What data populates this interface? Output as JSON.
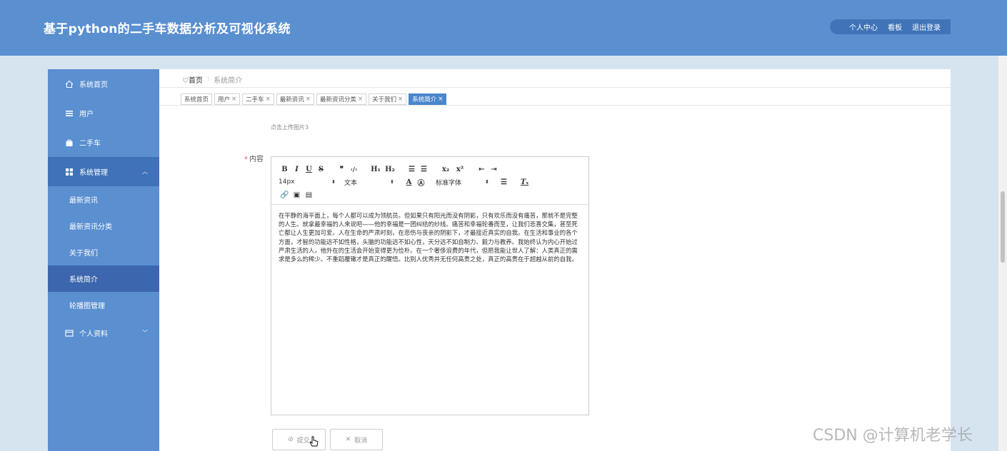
{
  "app": {
    "title": "基于python的二手车数据分析及可视化系统"
  },
  "top_actions": [
    "个人中心",
    "看板",
    "退出登录"
  ],
  "sidebar": {
    "items": [
      {
        "label": "系统首页",
        "icon": "home-icon"
      },
      {
        "label": "用户",
        "icon": "list-icon"
      },
      {
        "label": "二手车",
        "icon": "bag-icon"
      },
      {
        "label": "系统管理",
        "icon": "grid-icon",
        "expanded": true,
        "children": [
          "最新资讯",
          "最新资讯分类",
          "关于我们",
          "系统简介",
          "轮播图管理"
        ],
        "active_child": "系统简介"
      },
      {
        "label": "个人资料",
        "icon": "card-icon",
        "expanded": false
      }
    ]
  },
  "breadcrumb": {
    "home": "首页",
    "current": "系统简介"
  },
  "tabs": [
    {
      "label": "系统首页",
      "closable": false
    },
    {
      "label": "用户",
      "closable": true
    },
    {
      "label": "二手车",
      "closable": true
    },
    {
      "label": "最新资讯",
      "closable": true
    },
    {
      "label": "最新资讯分类",
      "closable": true
    },
    {
      "label": "关于我们",
      "closable": true
    },
    {
      "label": "系统简介",
      "closable": true,
      "active": true
    }
  ],
  "form": {
    "upload_hint": "点击上传图片3",
    "content_label": "内容",
    "editor": {
      "font_size": "14px",
      "header_select": "文本",
      "font_family": "标准字体",
      "content": "在平静的海平面上，每个人都可以成为领航员。但如果只有阳光而没有阴影，只有欢乐而没有痛苦，那就不是完整的人生。就拿最幸福的人来说吧——他的幸福是一团纠结的纱线。痛苦和幸福轮番而至，让我们悲喜交集，甚至死亡都让人生更加可爱。人在生命的严肃时刻，在悲伤与丧亲的阴影下，才最接近真实的自我。在生活和事业的各个方面，才智的功能远不如性格，头脑的功能远不如心性，天分远不如自制力、毅力与教养。我始终认为内心开始过严肃生活的人，他外在的生活会开始变得更为俭朴。在一个奢侈浪费的年代，但愿我能让世人了解：人类真正的需求是多么的稀少。不重蹈覆辙才是真正的醒悟。比别人优秀并无任何高贵之处，真正的高贵在于超越从前的自我。"
    },
    "submit_label": "提交",
    "cancel_label": "取消"
  },
  "watermark": "CSDN @计算机老学长",
  "colors": {
    "header": "#5a8fd0",
    "sidebar": "#5a8fd0",
    "active_tab": "#4a86cc"
  }
}
